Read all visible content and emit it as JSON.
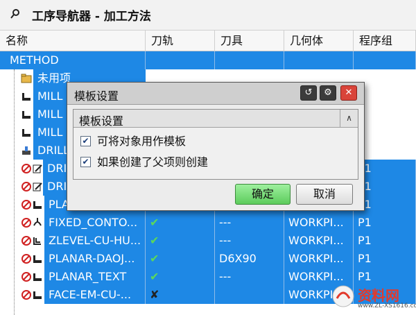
{
  "navigator": {
    "title": "工序导航器 - 加工方法"
  },
  "columns": [
    "名称",
    "刀轨",
    "刀具",
    "几何体",
    "程序组"
  ],
  "rows": [
    {
      "name": "METHOD",
      "path": "",
      "tool": "",
      "geom": "",
      "prog": ""
    },
    {
      "name": "未用项",
      "path": "",
      "tool": "",
      "geom": "",
      "prog": ""
    },
    {
      "name": "MILL",
      "path": "",
      "tool": "",
      "geom": "",
      "prog": ""
    },
    {
      "name": "MILL",
      "path": "",
      "tool": "",
      "geom": "",
      "prog": ""
    },
    {
      "name": "MILL",
      "path": "",
      "tool": "",
      "geom": "",
      "prog": ""
    },
    {
      "name": "DRILL",
      "path": "",
      "tool": "",
      "geom": "",
      "prog": ""
    },
    {
      "name": "DRI",
      "path": "",
      "tool": "",
      "geom": "",
      "prog": "P1"
    },
    {
      "name": "DRI",
      "path": "",
      "tool": "",
      "geom": "",
      "prog": "P1"
    },
    {
      "name": "PLANAR_MILL-...",
      "path": "✔",
      "tool": "---",
      "geom": "WORKPI...",
      "prog": "P1"
    },
    {
      "name": "FIXED_CONTO...",
      "path": "✔",
      "tool": "---",
      "geom": "WORKPI...",
      "prog": "P1"
    },
    {
      "name": "ZLEVEL-CU-HU...",
      "path": "✔",
      "tool": "---",
      "geom": "WORKPI...",
      "prog": "P1"
    },
    {
      "name": "PLANAR-DAOJ...",
      "path": "✔",
      "tool": "D6X90",
      "geom": "WORKPI...",
      "prog": "P1"
    },
    {
      "name": "PLANAR_TEXT",
      "path": "✔",
      "tool": "---",
      "geom": "WORKPI...",
      "prog": "P1"
    },
    {
      "name": "FACE-EM-CU-...",
      "path": "✘",
      "tool": "",
      "geom": "WORKPI...",
      "prog": ""
    }
  ],
  "dialog": {
    "title": "模板设置",
    "group_title": "模板设置",
    "option1": "可将对象用作模板",
    "option2": "如果创建了父项则创建",
    "option1_checked": true,
    "option2_checked": true,
    "ok_label": "确定",
    "cancel_label": "取消"
  },
  "watermark": {
    "text": "资料网",
    "sub": "www.ZL-XS1616.com"
  },
  "colors": {
    "selection": "#1e88e5",
    "ok_button": "#5ccc5c",
    "close_button": "#d9443a"
  }
}
